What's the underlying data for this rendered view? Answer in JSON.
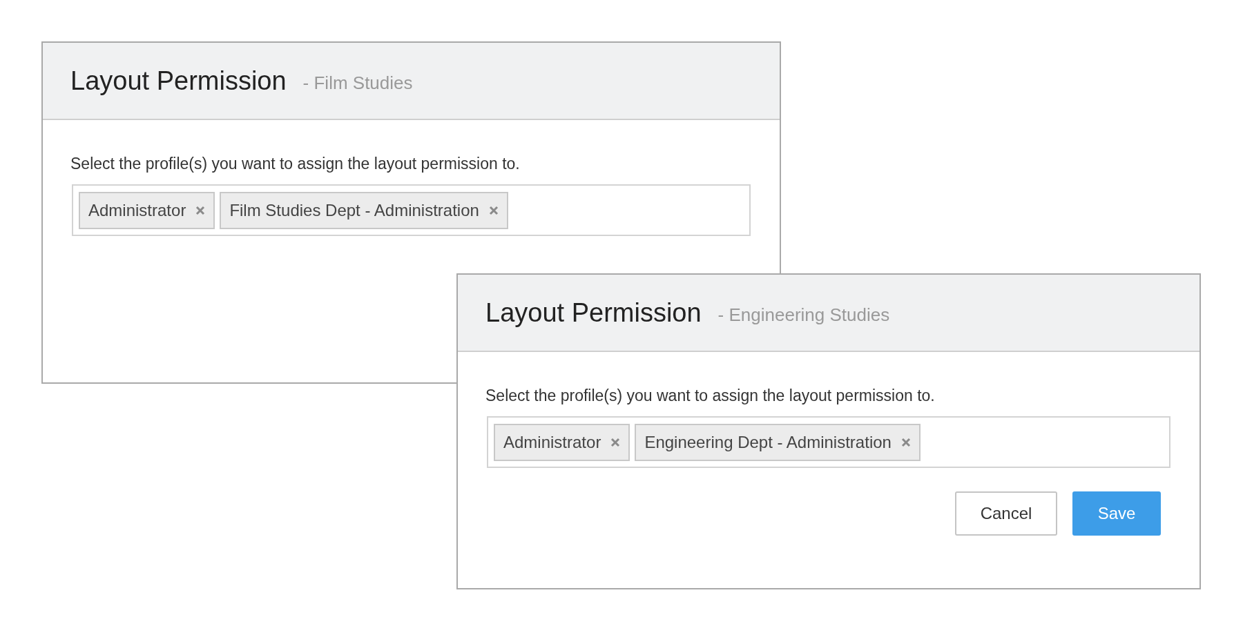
{
  "dialogs": [
    {
      "title": "Layout Permission",
      "subtitle": "- Film Studies",
      "instruction": "Select the profile(s) you want to assign the layout permission to.",
      "tags": [
        "Administrator",
        "Film Studies Dept - Administration"
      ]
    },
    {
      "title": "Layout Permission",
      "subtitle": "- Engineering Studies",
      "instruction": "Select the profile(s) you want to assign the layout permission to.",
      "tags": [
        "Administrator",
        "Engineering Dept - Administration"
      ],
      "buttons": [
        {
          "label": "Cancel",
          "kind": "secondary"
        },
        {
          "label": "Save",
          "kind": "primary"
        }
      ]
    }
  ]
}
